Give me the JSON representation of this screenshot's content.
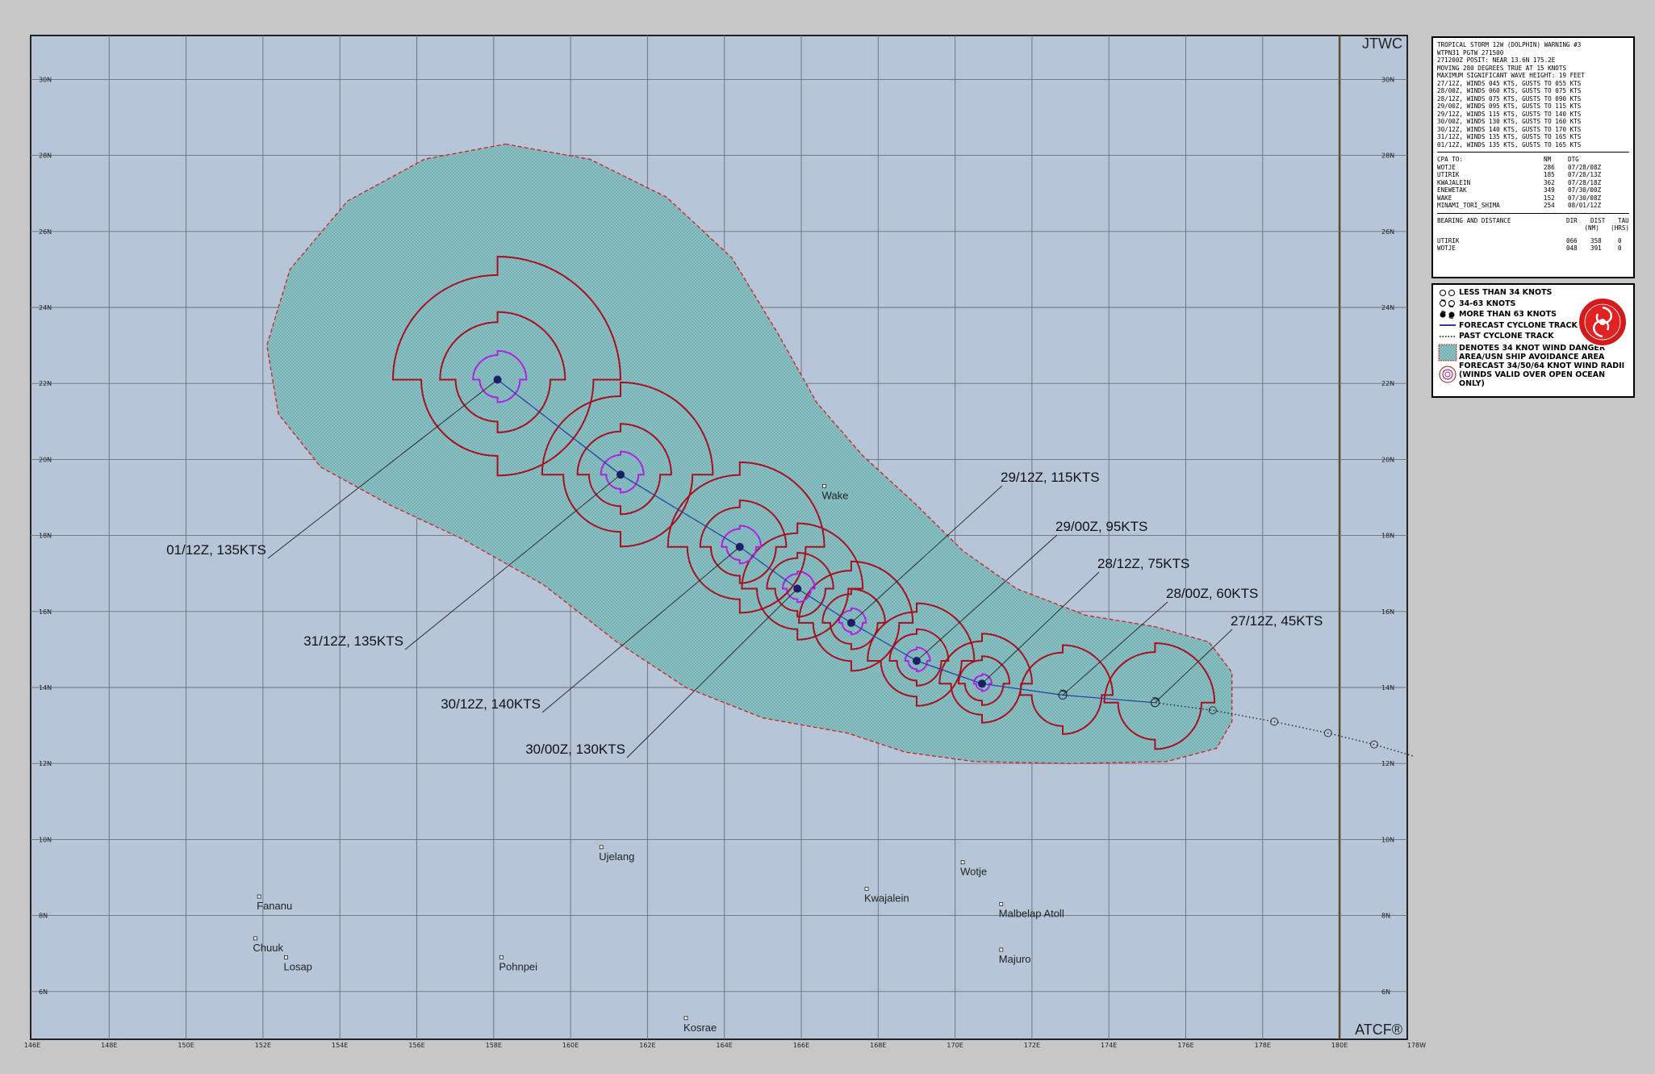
{
  "map": {
    "corner_labels": {
      "top_right": "JTWC",
      "bottom_right": "ATCF®"
    },
    "lon_labels": [
      "146E",
      "148E",
      "150E",
      "152E",
      "154E",
      "156E",
      "158E",
      "160E",
      "162E",
      "164E",
      "166E",
      "168E",
      "170E",
      "172E",
      "174E",
      "176E",
      "178E",
      "180E",
      "178W"
    ],
    "lat_labels": [
      "30N",
      "28N",
      "26N",
      "24N",
      "22N",
      "20N",
      "18N",
      "16N",
      "14N",
      "12N",
      "10N",
      "8N",
      "6N"
    ],
    "date_line_lon": 180,
    "extent": {
      "lon_min": 146,
      "lon_max": 182,
      "lat_min": 4.8,
      "lat_max": 31
    },
    "colors": {
      "ocean": "#b7c5d8",
      "grid": "#6b7078",
      "danger_area": "#8fc6c9",
      "danger_border": "#d02020",
      "radii_34": "#a80f1f",
      "radii_64": "#b020e0",
      "track": "#2a3aa0"
    }
  },
  "islands": [
    {
      "name": "Wake",
      "lon": 166.6,
      "lat": 19.3
    },
    {
      "name": "Ujelang",
      "lon": 160.8,
      "lat": 9.8
    },
    {
      "name": "Wotje",
      "lon": 170.2,
      "lat": 9.4
    },
    {
      "name": "Kwajalein",
      "lon": 167.7,
      "lat": 8.7
    },
    {
      "name": "Malbelap Atoll",
      "lon": 171.2,
      "lat": 8.3
    },
    {
      "name": "Majuro",
      "lon": 171.2,
      "lat": 7.1
    },
    {
      "name": "Fananu",
      "lon": 151.9,
      "lat": 8.5
    },
    {
      "name": "Chuuk",
      "lon": 151.8,
      "lat": 7.4
    },
    {
      "name": "Losap",
      "lon": 152.6,
      "lat": 6.9
    },
    {
      "name": "Pohnpei",
      "lon": 158.2,
      "lat": 6.9
    },
    {
      "name": "Kosrae",
      "lon": 163.0,
      "lat": 5.3
    }
  ],
  "forecast_track": [
    {
      "label": "27/12Z, 45KTS",
      "lon": 175.2,
      "lat": 13.6,
      "intensity": 45,
      "r34": 1.55,
      "r64": 0
    },
    {
      "label": "28/00Z, 60KTS",
      "lon": 172.8,
      "lat": 13.8,
      "intensity": 60,
      "r34": 1.3,
      "r64": 0
    },
    {
      "label": "28/12Z, 75KTS",
      "lon": 170.7,
      "lat": 14.1,
      "intensity": 75,
      "r34": 1.3,
      "r64": 0.25
    },
    {
      "label": "29/00Z, 95KTS",
      "lon": 169.0,
      "lat": 14.7,
      "intensity": 95,
      "r34": 1.5,
      "r64": 0.35
    },
    {
      "label": "29/12Z, 115KTS",
      "lon": 167.3,
      "lat": 15.7,
      "intensity": 115,
      "r34": 1.6,
      "r64": 0.38
    },
    {
      "label": "30/00Z, 130KTS",
      "lon": 165.9,
      "lat": 16.6,
      "intensity": 130,
      "r34": 1.7,
      "r64": 0.45
    },
    {
      "label": "30/12Z, 140KTS",
      "lon": 164.4,
      "lat": 17.7,
      "intensity": 140,
      "r34": 2.2,
      "r64": 0.55
    },
    {
      "label": "31/12Z, 135KTS",
      "lon": 161.3,
      "lat": 19.6,
      "intensity": 135,
      "r34": 2.4,
      "r64": 0.6
    },
    {
      "label": "01/12Z, 135KTS",
      "lon": 158.1,
      "lat": 22.1,
      "intensity": 135,
      "r34": 3.2,
      "r64": 0.75
    }
  ],
  "past_track": [
    {
      "lon": 181.9,
      "lat": 12.2
    },
    {
      "lon": 180.9,
      "lat": 12.5
    },
    {
      "lon": 179.7,
      "lat": 12.8
    },
    {
      "lon": 178.3,
      "lat": 13.1
    },
    {
      "lon": 176.7,
      "lat": 13.4
    },
    {
      "lon": 175.2,
      "lat": 13.6
    }
  ],
  "info": {
    "header": [
      "TROPICAL STORM 12W (DOLPHIN) WARNING #3",
      "WTPN31 PGTW 271500",
      "271200Z POSIT: NEAR 13.6N 175.2E",
      "MOVING 280 DEGREES TRUE AT 15 KNOTS",
      "MAXIMUM SIGNIFICANT WAVE HEIGHT: 19 FEET",
      "27/12Z, WINDS 045 KTS, GUSTS TO 055 KTS",
      "28/00Z, WINDS 060 KTS, GUSTS TO 075 KTS",
      "28/12Z, WINDS 075 KTS, GUSTS TO 090 KTS",
      "29/00Z, WINDS 095 KTS, GUSTS TO 115 KTS",
      "29/12Z, WINDS 115 KTS, GUSTS TO 140 KTS",
      "30/00Z, WINDS 130 KTS, GUSTS TO 160 KTS",
      "30/12Z, WINDS 140 KTS, GUSTS TO 170 KTS",
      "31/12Z, WINDS 135 KTS, GUSTS TO 165 KTS",
      "01/12Z, WINDS 135 KTS, GUSTS TO 165 KTS"
    ],
    "cpa_header": [
      "CPA TO:",
      "NM",
      "DTG"
    ],
    "cpa": [
      [
        "WOTJE",
        "286",
        "07/28/08Z"
      ],
      [
        "UTIRIK",
        "185",
        "07/28/13Z"
      ],
      [
        "KWAJALEIN",
        "362",
        "07/28/18Z"
      ],
      [
        "ENEWETAK",
        "349",
        "07/30/00Z"
      ],
      [
        "WAKE",
        "152",
        "07/30/08Z"
      ],
      [
        "MINAMI_TORI_SHIMA",
        "254",
        "08/01/12Z"
      ]
    ],
    "brg_header": [
      "BEARING AND DISTANCE",
      "DIR",
      "DIST",
      "TAU"
    ],
    "brg_header2": [
      "",
      "",
      "(NM)",
      "(HRS)"
    ],
    "brg": [
      [
        "UTIRIK",
        "066",
        "358",
        "0"
      ],
      [
        "WOTJE",
        "048",
        "391",
        "0"
      ]
    ]
  },
  "legend": {
    "lt34": "LESS THAN 34 KNOTS",
    "k3463": "34-63 KNOTS",
    "gt63": "MORE THAN 63 KNOTS",
    "forecast": "FORECAST CYCLONE TRACK",
    "past": "PAST CYCLONE TRACK",
    "danger1": "DENOTES 34 KNOT WIND DANGER",
    "danger2": "AREA/USN SHIP AVOIDANCE AREA",
    "radii1": "FORECAST 34/50/64 KNOT WIND RADII",
    "radii2": "(WINDS VALID OVER OPEN OCEAN ONLY)"
  }
}
